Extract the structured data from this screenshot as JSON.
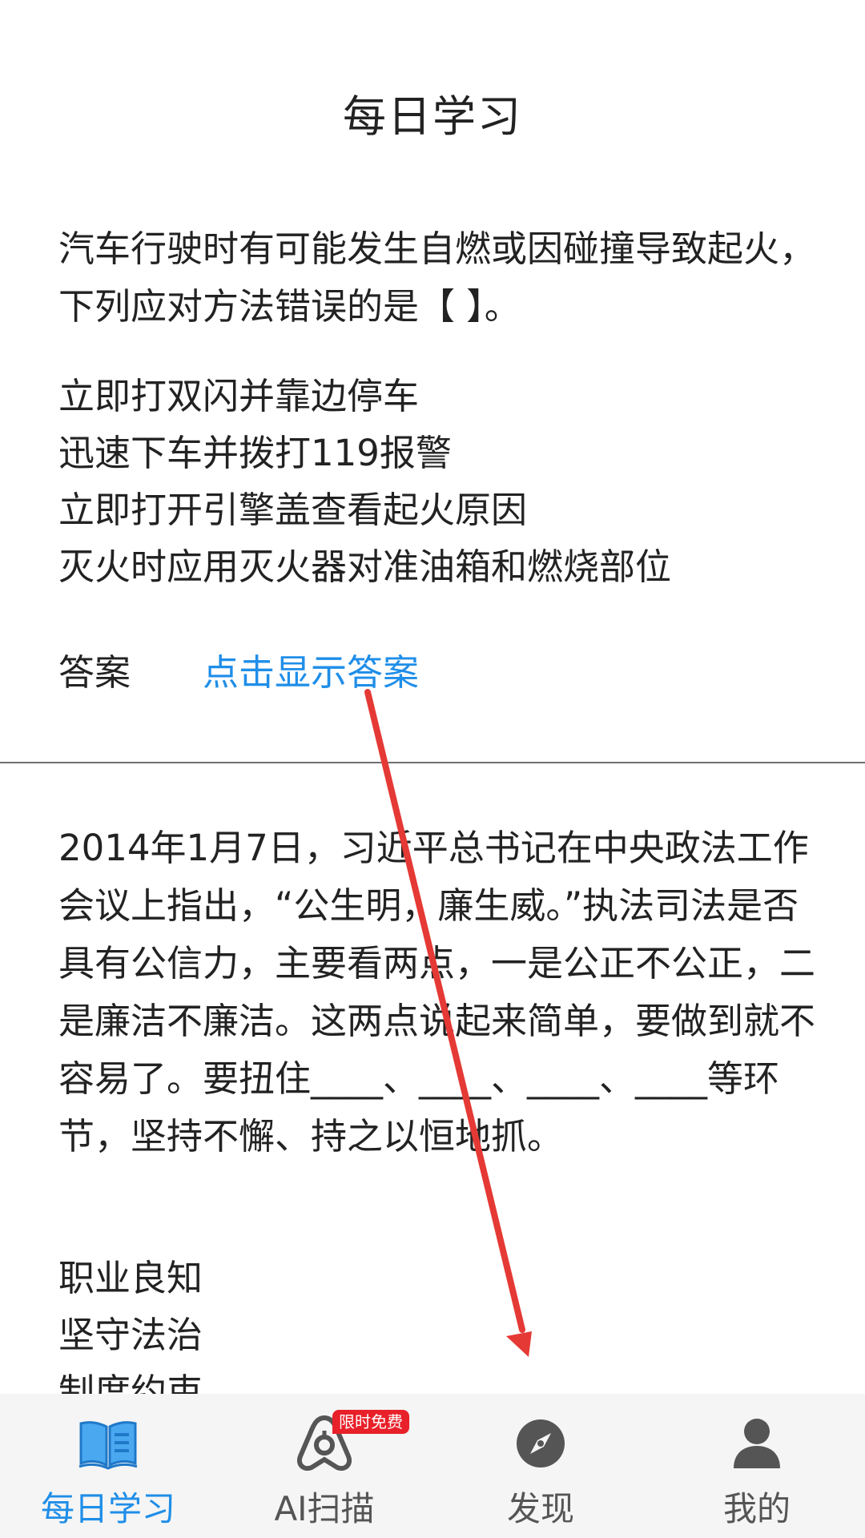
{
  "header": {
    "title": "每日学习"
  },
  "question1": {
    "text": "汽车行驶时有可能发生自燃或因碰撞导致起火，下列应对方法错误的是【 】。",
    "options": [
      "立即打双闪并靠边停车",
      "迅速下车并拨打119报警",
      "立即打开引擎盖查看起火原因",
      "灭火时应用灭火器对准油箱和燃烧部位"
    ],
    "answer_label": "答案",
    "answer_link": "点击显示答案"
  },
  "question2": {
    "text": "2014年1月7日，习近平总书记在中央政法工作会议上指出，“公生明，廉生威。”执法司法是否具有公信力，主要看两点，一是公正不公正，二是廉洁不廉洁。这两点说起来简单，要做到就不容易了。要扭住____、____、____、____等环节，坚持不懈、持之以恒地抓。",
    "options": [
      "职业良知",
      "坚守法治",
      "制度约束"
    ]
  },
  "tabbar": {
    "tabs": [
      {
        "label": "每日学习",
        "icon": "book-icon",
        "active": true
      },
      {
        "label": "AI扫描",
        "icon": "ai-scan-icon",
        "badge": "限时免费"
      },
      {
        "label": "发现",
        "icon": "compass-icon"
      },
      {
        "label": "我的",
        "icon": "person-icon"
      }
    ]
  },
  "colors": {
    "accent": "#1f8ee8",
    "badge": "#e8202a",
    "annotation_arrow": "#e53935"
  }
}
